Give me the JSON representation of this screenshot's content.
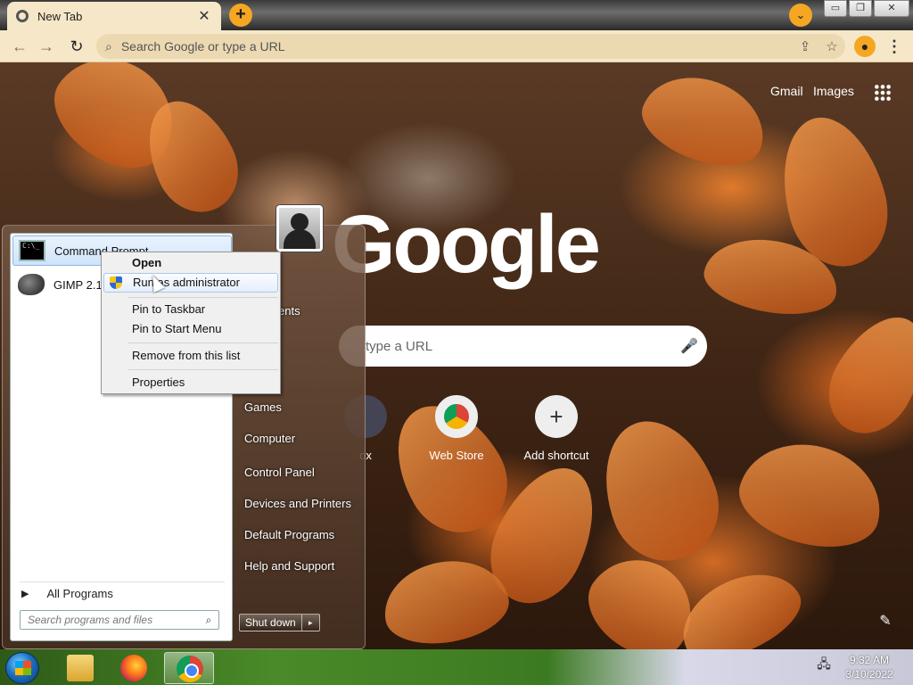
{
  "browser": {
    "tab_title": "New Tab",
    "tab_close": "✕",
    "new_tab": "+",
    "tab_search": "⌄",
    "window_controls": {
      "minimize": "▭",
      "restore": "❐",
      "close": "✕"
    },
    "back": "←",
    "forward": "→",
    "reload": "↻",
    "omnibox_placeholder": "Search Google or type a URL",
    "share_icon": "⇪",
    "star_icon": "☆",
    "kebab": "⋮"
  },
  "newtab": {
    "gmail": "Gmail",
    "images": "Images",
    "logo": "Google",
    "search_placeholder": "type a URL",
    "shortcuts": [
      {
        "label": "ox",
        "icon": ""
      },
      {
        "label": "Web Store",
        "icon": ""
      },
      {
        "label": "Add shortcut",
        "icon": "+"
      }
    ],
    "edit_icon": "✎"
  },
  "start_menu": {
    "programs": [
      {
        "label": "Command Prompt",
        "icon": "command-prompt-icon"
      },
      {
        "label": "GIMP 2.10.2",
        "icon": "gimp-icon"
      }
    ],
    "all_programs": "All Programs",
    "search_placeholder": "Search programs and files",
    "right_links": [
      "ents",
      "Games",
      "Computer",
      "Control Panel",
      "Devices and Printers",
      "Default Programs",
      "Help and Support"
    ],
    "shutdown": "Shut down",
    "shutdown_arrow": "▸"
  },
  "context_menu": {
    "items": [
      "Open",
      "Run as administrator",
      "Pin to Taskbar",
      "Pin to Start Menu",
      "Remove from this list",
      "Properties"
    ]
  },
  "taskbar": {
    "time": "9:32 AM",
    "date": "3/10/2022"
  },
  "colors": {
    "chrome_accent": "#f5a623",
    "toolbar_bg": "#f6e7c8",
    "menu_highlight": "#cfe3fa"
  }
}
